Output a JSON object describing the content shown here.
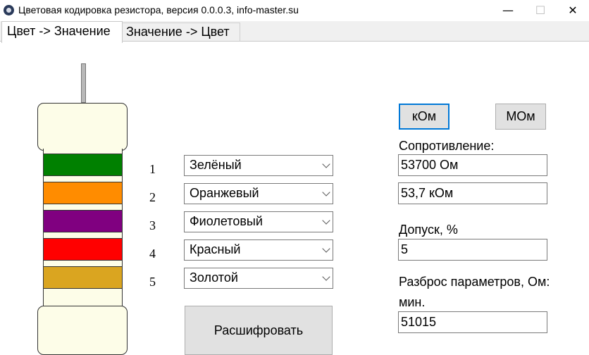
{
  "window": {
    "title": "Цветовая кодировка резистора, версия 0.0.0.3, info-master.su",
    "minimize": "—",
    "maximize": "☐",
    "close": "✕"
  },
  "tabs": [
    {
      "label": "Цвет -> Значение",
      "active": true
    },
    {
      "label": "Значение -> Цвет",
      "active": false
    }
  ],
  "bands": [
    {
      "number": "1",
      "color_name": "Зелёный",
      "color": "#008000"
    },
    {
      "number": "2",
      "color_name": "Оранжевый",
      "color": "#ff8c00"
    },
    {
      "number": "3",
      "color_name": "Фиолетовый",
      "color": "#800080"
    },
    {
      "number": "4",
      "color_name": "Красный",
      "color": "#ff0000"
    },
    {
      "number": "5",
      "color_name": "Золотой",
      "color": "#daa520"
    }
  ],
  "decode_button": "Расшифровать",
  "unit_buttons": {
    "kom": "кОм",
    "mom": "МОм"
  },
  "resistance": {
    "label": "Сопротивление:",
    "ohms": "53700 Ом",
    "scaled": "53,7 кОм"
  },
  "tolerance": {
    "label": "Допуск, %",
    "value": "5"
  },
  "spread": {
    "label": "Разброс параметров, Ом:",
    "min_label": "мин.",
    "min_value": "51015"
  }
}
